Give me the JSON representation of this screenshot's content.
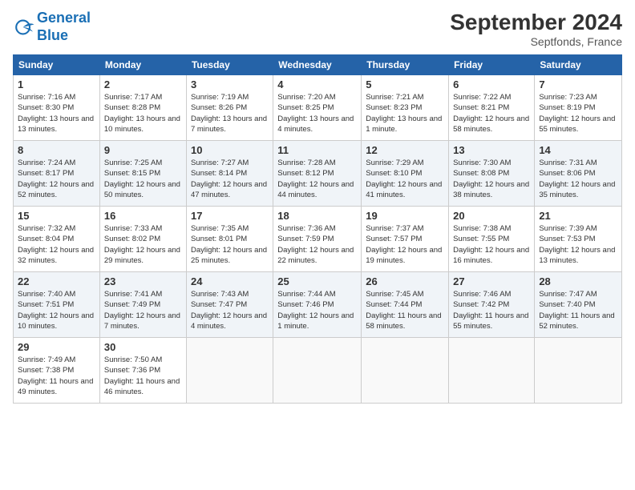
{
  "header": {
    "logo_line1": "General",
    "logo_line2": "Blue",
    "month": "September 2024",
    "location": "Septfonds, France"
  },
  "columns": [
    "Sunday",
    "Monday",
    "Tuesday",
    "Wednesday",
    "Thursday",
    "Friday",
    "Saturday"
  ],
  "rows": [
    [
      {
        "num": "1",
        "rise": "Sunrise: 7:16 AM",
        "set": "Sunset: 8:30 PM",
        "day": "Daylight: 13 hours and 13 minutes."
      },
      {
        "num": "2",
        "rise": "Sunrise: 7:17 AM",
        "set": "Sunset: 8:28 PM",
        "day": "Daylight: 13 hours and 10 minutes."
      },
      {
        "num": "3",
        "rise": "Sunrise: 7:19 AM",
        "set": "Sunset: 8:26 PM",
        "day": "Daylight: 13 hours and 7 minutes."
      },
      {
        "num": "4",
        "rise": "Sunrise: 7:20 AM",
        "set": "Sunset: 8:25 PM",
        "day": "Daylight: 13 hours and 4 minutes."
      },
      {
        "num": "5",
        "rise": "Sunrise: 7:21 AM",
        "set": "Sunset: 8:23 PM",
        "day": "Daylight: 13 hours and 1 minute."
      },
      {
        "num": "6",
        "rise": "Sunrise: 7:22 AM",
        "set": "Sunset: 8:21 PM",
        "day": "Daylight: 12 hours and 58 minutes."
      },
      {
        "num": "7",
        "rise": "Sunrise: 7:23 AM",
        "set": "Sunset: 8:19 PM",
        "day": "Daylight: 12 hours and 55 minutes."
      }
    ],
    [
      {
        "num": "8",
        "rise": "Sunrise: 7:24 AM",
        "set": "Sunset: 8:17 PM",
        "day": "Daylight: 12 hours and 52 minutes."
      },
      {
        "num": "9",
        "rise": "Sunrise: 7:25 AM",
        "set": "Sunset: 8:15 PM",
        "day": "Daylight: 12 hours and 50 minutes."
      },
      {
        "num": "10",
        "rise": "Sunrise: 7:27 AM",
        "set": "Sunset: 8:14 PM",
        "day": "Daylight: 12 hours and 47 minutes."
      },
      {
        "num": "11",
        "rise": "Sunrise: 7:28 AM",
        "set": "Sunset: 8:12 PM",
        "day": "Daylight: 12 hours and 44 minutes."
      },
      {
        "num": "12",
        "rise": "Sunrise: 7:29 AM",
        "set": "Sunset: 8:10 PM",
        "day": "Daylight: 12 hours and 41 minutes."
      },
      {
        "num": "13",
        "rise": "Sunrise: 7:30 AM",
        "set": "Sunset: 8:08 PM",
        "day": "Daylight: 12 hours and 38 minutes."
      },
      {
        "num": "14",
        "rise": "Sunrise: 7:31 AM",
        "set": "Sunset: 8:06 PM",
        "day": "Daylight: 12 hours and 35 minutes."
      }
    ],
    [
      {
        "num": "15",
        "rise": "Sunrise: 7:32 AM",
        "set": "Sunset: 8:04 PM",
        "day": "Daylight: 12 hours and 32 minutes."
      },
      {
        "num": "16",
        "rise": "Sunrise: 7:33 AM",
        "set": "Sunset: 8:02 PM",
        "day": "Daylight: 12 hours and 29 minutes."
      },
      {
        "num": "17",
        "rise": "Sunrise: 7:35 AM",
        "set": "Sunset: 8:01 PM",
        "day": "Daylight: 12 hours and 25 minutes."
      },
      {
        "num": "18",
        "rise": "Sunrise: 7:36 AM",
        "set": "Sunset: 7:59 PM",
        "day": "Daylight: 12 hours and 22 minutes."
      },
      {
        "num": "19",
        "rise": "Sunrise: 7:37 AM",
        "set": "Sunset: 7:57 PM",
        "day": "Daylight: 12 hours and 19 minutes."
      },
      {
        "num": "20",
        "rise": "Sunrise: 7:38 AM",
        "set": "Sunset: 7:55 PM",
        "day": "Daylight: 12 hours and 16 minutes."
      },
      {
        "num": "21",
        "rise": "Sunrise: 7:39 AM",
        "set": "Sunset: 7:53 PM",
        "day": "Daylight: 12 hours and 13 minutes."
      }
    ],
    [
      {
        "num": "22",
        "rise": "Sunrise: 7:40 AM",
        "set": "Sunset: 7:51 PM",
        "day": "Daylight: 12 hours and 10 minutes."
      },
      {
        "num": "23",
        "rise": "Sunrise: 7:41 AM",
        "set": "Sunset: 7:49 PM",
        "day": "Daylight: 12 hours and 7 minutes."
      },
      {
        "num": "24",
        "rise": "Sunrise: 7:43 AM",
        "set": "Sunset: 7:47 PM",
        "day": "Daylight: 12 hours and 4 minutes."
      },
      {
        "num": "25",
        "rise": "Sunrise: 7:44 AM",
        "set": "Sunset: 7:46 PM",
        "day": "Daylight: 12 hours and 1 minute."
      },
      {
        "num": "26",
        "rise": "Sunrise: 7:45 AM",
        "set": "Sunset: 7:44 PM",
        "day": "Daylight: 11 hours and 58 minutes."
      },
      {
        "num": "27",
        "rise": "Sunrise: 7:46 AM",
        "set": "Sunset: 7:42 PM",
        "day": "Daylight: 11 hours and 55 minutes."
      },
      {
        "num": "28",
        "rise": "Sunrise: 7:47 AM",
        "set": "Sunset: 7:40 PM",
        "day": "Daylight: 11 hours and 52 minutes."
      }
    ],
    [
      {
        "num": "29",
        "rise": "Sunrise: 7:49 AM",
        "set": "Sunset: 7:38 PM",
        "day": "Daylight: 11 hours and 49 minutes."
      },
      {
        "num": "30",
        "rise": "Sunrise: 7:50 AM",
        "set": "Sunset: 7:36 PM",
        "day": "Daylight: 11 hours and 46 minutes."
      },
      null,
      null,
      null,
      null,
      null
    ]
  ]
}
